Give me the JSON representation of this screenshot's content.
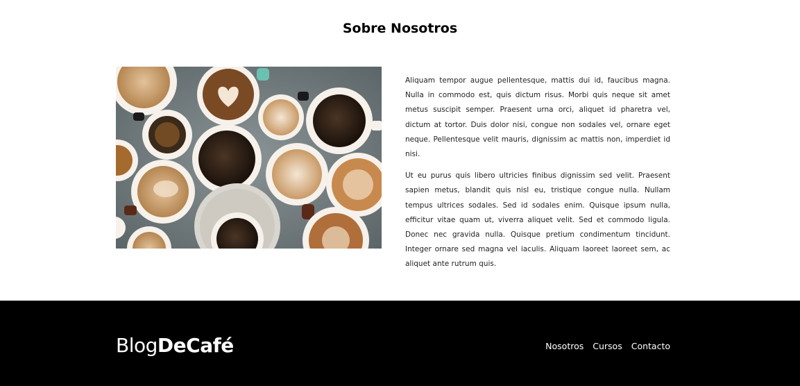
{
  "about": {
    "title": "Sobre Nosotros",
    "image_alt": "coffee-cups-photo",
    "paragraphs": [
      "Aliquam tempor augue pellentesque, mattis dui id, faucibus magna. Nulla in commodo est, quis dictum risus. Morbi quis neque sit amet metus suscipit semper. Praesent urna orci, aliquet id pharetra vel, dictum at tortor. Duis dolor nisi, congue non sodales vel, ornare eget neque. Pellentesque velit mauris, dignissim ac mattis non, imperdiet id nisi.",
      "Ut eu purus quis libero ultricies finibus dignissim sed velit. Praesent sapien metus, blandit quis nisl eu, tristique congue nulla. Nullam tempus ultrices sodales. Sed id sodales enim. Quisque ipsum nulla, efficitur vitae quam ut, viverra aliquet velit. Sed et commodo ligula. Donec nec gravida nulla. Quisque pretium condimentum tincidunt. Integer ornare sed magna vel iaculis. Aliquam laoreet laoreet sem, ac aliquet ante rutrum quis."
    ]
  },
  "footer": {
    "logo_light": "Blog",
    "logo_bold": "DeCafé",
    "nav": [
      {
        "label": "Nosotros"
      },
      {
        "label": "Cursos"
      },
      {
        "label": "Contacto"
      }
    ]
  },
  "colors": {
    "footer_bg": "#000000",
    "footer_text": "#ffffff",
    "table_surface": "#6f7a7c"
  }
}
